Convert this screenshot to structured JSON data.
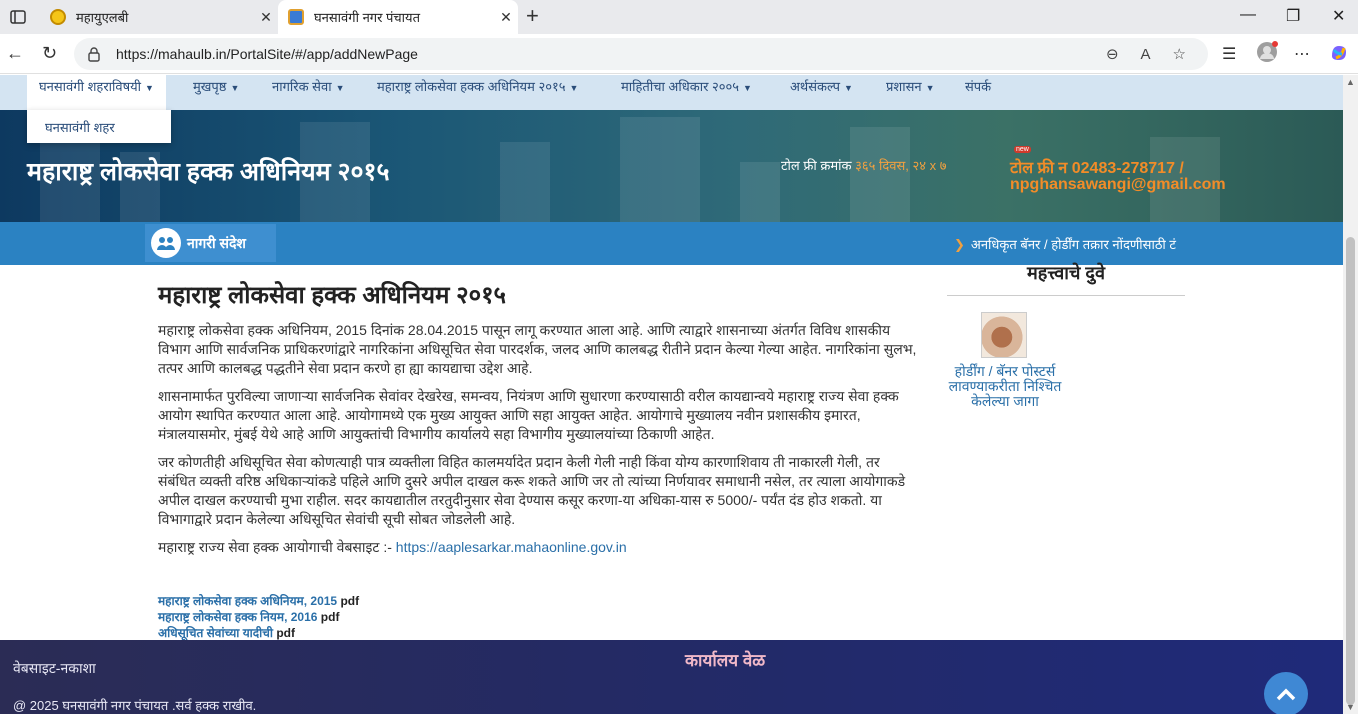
{
  "browser": {
    "tabs": [
      {
        "title": "महायुएलबी",
        "active": false
      },
      {
        "title": "घनसावंगी नगर पंचायत",
        "active": true
      }
    ],
    "url": "https://mahaulb.in/PortalSite/#/app/addNewPage"
  },
  "nav": {
    "items": [
      {
        "label": "घनसावंगी शहराविषयी",
        "caret": true
      },
      {
        "label": "मुखपृष्ठ",
        "caret": true
      },
      {
        "label": "नागरिक सेवा",
        "caret": true
      },
      {
        "label": "महाराष्ट्र लोकसेवा हक्क अधिनियम २०१५",
        "caret": true
      },
      {
        "label": "माहितीचा अधिकार २००५",
        "caret": true
      },
      {
        "label": "अर्थसंकल्प",
        "caret": true
      },
      {
        "label": "प्रशासन",
        "caret": true
      },
      {
        "label": "संपर्क",
        "caret": false
      }
    ],
    "dropdown_item": "घनसावंगी शहर"
  },
  "banner": {
    "title": "महाराष्ट्र लोकसेवा हक्क अधिनियम २०१५",
    "toll_label": "टोल फ्री क्रमांक",
    "toll_hours": "३६५ दिवस, २४ x ७",
    "new_badge": "new",
    "toll_number": "टोल फ्री न 02483-278717  /",
    "email": "npghansawangi@gmail.com"
  },
  "news": {
    "label": "नागरी संदेश",
    "ticker": "अनधिकृत बॅनर / होर्डींग तक्रार नोंदणीसाठी टं"
  },
  "content": {
    "heading": "महाराष्ट्र लोकसेवा हक्क अधिनियम २०१५",
    "paragraphs": [
      "महाराष्ट्र लोकसेवा हक्क अधिनियम, 2015 दिनांक 28.04.2015 पासून लागू करण्यात आला आहे. आणि त्याद्वारे शासनाच्या अंतर्गत विविध शासकीय विभाग आणि सार्वजनिक प्राधिकरणांद्वारे नागरिकांना अधिसूचित सेवा पारदर्शक, जलद आणि कालबद्ध रीतीने प्रदान केल्या गेल्या आहेत. नागरिकांना सुलभ, तत्पर आणि कालबद्ध पद्धतीने सेवा प्रदान करणे हा ह्या कायद्याचा उद्देश आहे.",
      "शासनामार्फत पुरविल्या जाणाऱ्या सार्वजनिक सेवांवर देखरेख, समन्वय, नियंत्रण आणि सुधारणा करण्यासाठी वरील कायद्यान्वये महाराष्ट्र राज्य सेवा हक्क आयोग स्थापित करण्यात आला आहे. आयोगामध्ये एक मुख्य आयुक्त आणि सहा आयुक्त आहेत. आयोगाचे मुख्यालय नवीन प्रशासकीय इमारत, मंत्रालयासमोर, मुंबई येथे आहे आणि आयुक्तांची विभागीय कार्यालये सहा विभागीय मुख्यालयांच्या ठिकाणी आहेत.",
      "जर कोणतीही अधिसूचित सेवा कोणत्याही पात्र व्यक्तीला विहित कालमर्यादेत प्रदान केली गेली नाही किंवा योग्य कारणाशिवाय ती नाकारली गेली, तर संबंधित व्यक्ती वरिष्ठ अधिकाऱ्यांकडे पहिले आणि दुसरे अपील दाखल करू शकते आणि जर तो त्यांच्या निर्णयावर समाधानी नसेल, तर त्याला आयोगाकडे अपील दाखल करण्याची मुभा राहील. सदर कायद्यातील तरतुदीनुसार सेवा देण्यास कसूर करणा-या अधिका-यास  रु 5000/- पर्यंत दंड होउ शकतो. या विभागाद्वारे प्रदान केलेल्या अधिसूचित सेवांची सूची सोबत जोडलेली आहे."
    ],
    "website_label": "महाराष्ट्र राज्य सेवा हक्क आयोगाची वेबसाइट :- ",
    "website_link": "https://aaplesarkar.mahaonline.gov.in",
    "pdfs": [
      {
        "link": "महाराष्ट्र लोकसेवा हक्क अधिनियम, 2015",
        "suffix": "pdf"
      },
      {
        "link": "महाराष्ट्र लोकसेवा हक्क नियम, 2016",
        "suffix": "pdf"
      },
      {
        "link": "अधिसूचित सेवांच्या यादीची",
        "suffix": "pdf"
      }
    ]
  },
  "sidebar": {
    "heading": "महत्त्वाचे दुवे",
    "link_caption": "होर्डींग / बॅनर पोस्टर्स लावण्याकरीता निश्चित केलेल्या जागा"
  },
  "footer": {
    "sitemap": "वेबसाइट-नकाशा",
    "office_hours": "कार्यालय वेळ",
    "copyright": "@ 2025 घनसावंगी नगर पंचायत .सर्व हक्क राखीव."
  }
}
